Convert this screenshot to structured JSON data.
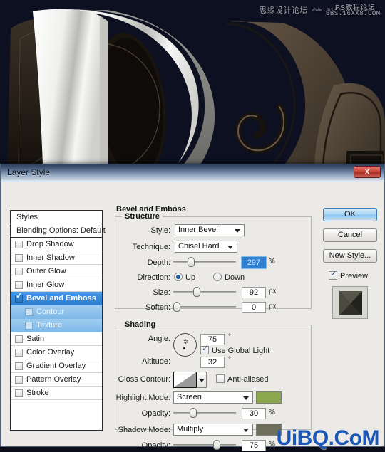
{
  "artwork": {
    "description": "chocolate-lettering-artwork",
    "watermarks": {
      "left": "思缘设计论坛",
      "url": "www.missyuan.com",
      "right": "PS教程论坛",
      "bbs": "BBS.16XX8.COM",
      "bottom": "UiBQ.CoM"
    },
    "colors": {
      "background": "#0d1020",
      "chocolate": "#574a3c",
      "letter": "#f2f2f0"
    }
  },
  "dialog": {
    "title": "Layer Style",
    "close_label": "x"
  },
  "styles_panel": {
    "header": "Styles",
    "blending_options": "Blending Options: Default",
    "items": [
      {
        "label": "Drop Shadow",
        "checked": false,
        "state": "normal",
        "indent": false
      },
      {
        "label": "Inner Shadow",
        "checked": false,
        "state": "normal",
        "indent": false
      },
      {
        "label": "Outer Glow",
        "checked": false,
        "state": "normal",
        "indent": false
      },
      {
        "label": "Inner Glow",
        "checked": false,
        "state": "normal",
        "indent": false
      },
      {
        "label": "Bevel and Emboss",
        "checked": true,
        "state": "selected",
        "indent": false
      },
      {
        "label": "Contour",
        "checked": false,
        "state": "child",
        "indent": true
      },
      {
        "label": "Texture",
        "checked": false,
        "state": "child",
        "indent": true
      },
      {
        "label": "Satin",
        "checked": false,
        "state": "normal",
        "indent": false
      },
      {
        "label": "Color Overlay",
        "checked": false,
        "state": "normal",
        "indent": false
      },
      {
        "label": "Gradient Overlay",
        "checked": false,
        "state": "normal",
        "indent": false
      },
      {
        "label": "Pattern Overlay",
        "checked": false,
        "state": "normal",
        "indent": false
      },
      {
        "label": "Stroke",
        "checked": false,
        "state": "normal",
        "indent": false
      }
    ]
  },
  "main": {
    "panel_title": "Bevel and Emboss",
    "structure": {
      "title": "Structure",
      "style_label": "Style:",
      "style_value": "Inner Bevel",
      "technique_label": "Technique:",
      "technique_value": "Chisel Hard",
      "depth_label": "Depth:",
      "depth_value": "297",
      "depth_unit": "%",
      "depth_slider_pct": 26,
      "direction_label": "Direction:",
      "direction_up": "Up",
      "direction_down": "Down",
      "direction_selected": "Up",
      "size_label": "Size:",
      "size_value": "92",
      "size_unit": "px",
      "size_slider_pct": 36,
      "soften_label": "Soften:",
      "soften_value": "0",
      "soften_unit": "px",
      "soften_slider_pct": 0
    },
    "shading": {
      "title": "Shading",
      "angle_label": "Angle:",
      "angle_value": "75",
      "angle_unit": "°",
      "global_light_label": "Use Global Light",
      "global_light_checked": true,
      "altitude_label": "Altitude:",
      "altitude_value": "32",
      "altitude_unit": "°",
      "gloss_contour_label": "Gloss Contour:",
      "anti_aliased_label": "Anti-aliased",
      "anti_aliased_checked": false,
      "highlight_mode_label": "Highlight Mode:",
      "highlight_mode_value": "Screen",
      "highlight_color": "#8ca84e",
      "highlight_opacity_label": "Opacity:",
      "highlight_opacity_value": "30",
      "highlight_opacity_unit": "%",
      "highlight_opacity_pct": 30,
      "shadow_mode_label": "Shadow Mode:",
      "shadow_mode_value": "Multiply",
      "shadow_color": "#6e6e5c",
      "shadow_opacity_label": "Opacity:",
      "shadow_opacity_value": "75",
      "shadow_opacity_unit": "%",
      "shadow_opacity_pct": 72
    }
  },
  "buttons": {
    "ok": "OK",
    "cancel": "Cancel",
    "new_style": "New Style...",
    "preview_label": "Preview",
    "preview_checked": true
  }
}
